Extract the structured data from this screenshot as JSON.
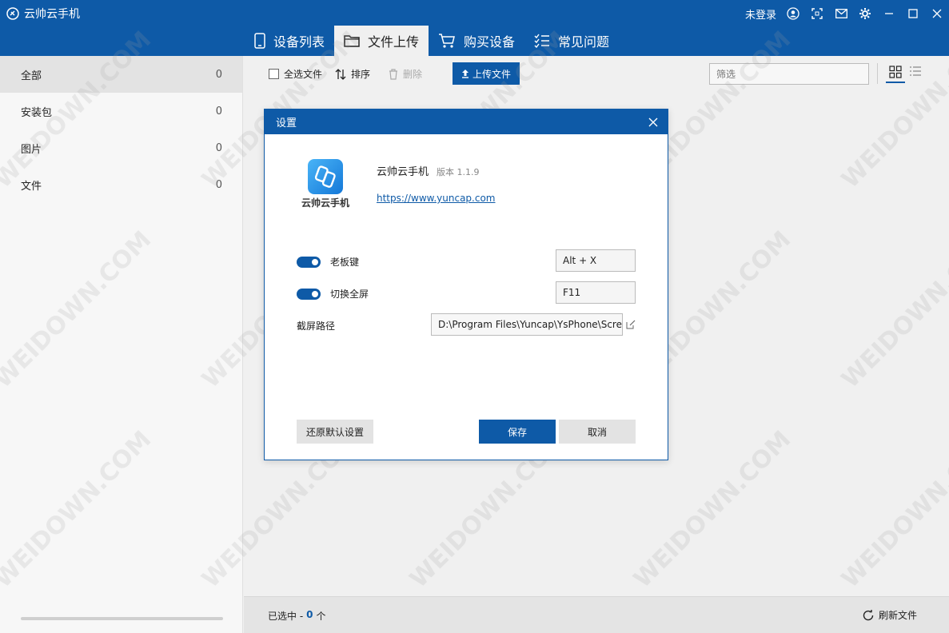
{
  "app": {
    "title": "云帅云手机"
  },
  "window": {
    "login_label": "未登录"
  },
  "nav": {
    "tabs": [
      {
        "label": "设备列表",
        "icon": "phone-icon"
      },
      {
        "label": "文件上传",
        "icon": "folder-icon",
        "active": true
      },
      {
        "label": "购买设备",
        "icon": "cart-icon"
      },
      {
        "label": "常见问题",
        "icon": "checklist-icon"
      }
    ]
  },
  "sidebar": {
    "items": [
      {
        "label": "全部",
        "count": "0"
      },
      {
        "label": "安装包",
        "count": "0"
      },
      {
        "label": "图片",
        "count": "0"
      },
      {
        "label": "文件",
        "count": "0"
      }
    ]
  },
  "toolbar": {
    "select_all": "全选文件",
    "sort": "排序",
    "delete": "删除",
    "upload": "上传文件",
    "filter_placeholder": "筛选"
  },
  "status": {
    "selected_prefix": "已选中 -",
    "selected_count": "0",
    "selected_suffix": "个",
    "refresh": "刷新文件"
  },
  "dialog": {
    "title": "设置",
    "app_name": "云帅云手机",
    "logo_text": "云帅云手机",
    "version": "版本 1.1.9",
    "link": "https://www.yuncap.com",
    "boss_key_label": "老板键",
    "boss_key_value": "Alt + X",
    "fullscreen_label": "切换全屏",
    "fullscreen_value": "F11",
    "screenshot_path_label": "截屏路径",
    "screenshot_path_value": "D:\\Program Files\\Yuncap\\YsPhone\\Screenshots",
    "reset_button": "还原默认设置",
    "save_button": "保存",
    "cancel_button": "取消"
  },
  "watermark": {
    "text": "WEIDOWN.COM"
  },
  "colors": {
    "accent": "#0e5aa7",
    "background": "#f0f0f0"
  }
}
